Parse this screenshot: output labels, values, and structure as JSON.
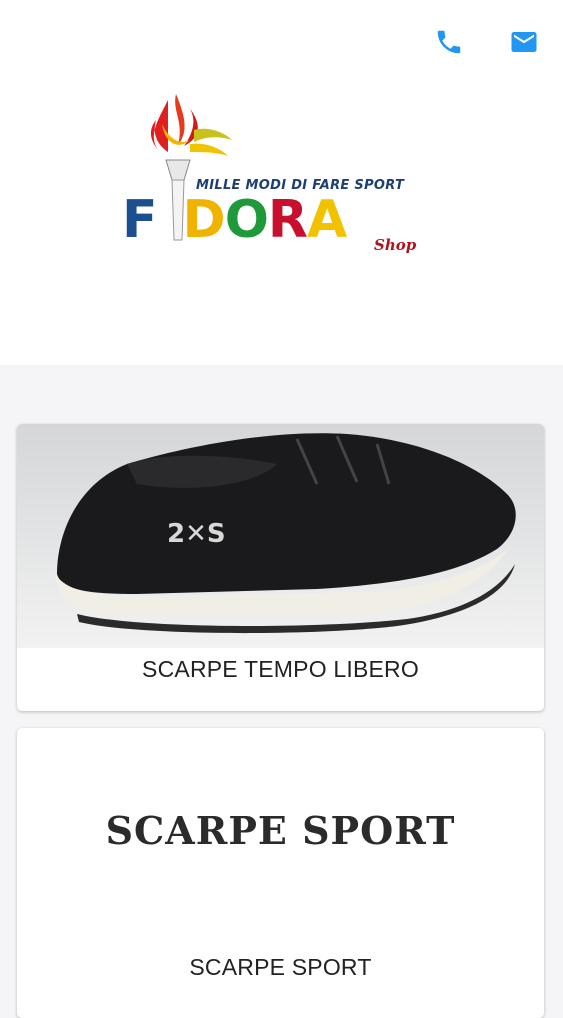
{
  "header": {
    "phone_icon": "phone-icon",
    "mail_icon": "mail-icon",
    "accent_color": "#2196f3",
    "logo": {
      "tagline": "MILLE MODI DI FARE SPORT",
      "brand_letters": [
        "F",
        "I",
        "D",
        "O",
        "R",
        "A"
      ],
      "brand_colors": [
        "#1c4f8f",
        "#cfa300",
        "#f0b400",
        "#1f9a3b",
        "#c8102e",
        "#f2c200"
      ],
      "shop": "Shop"
    }
  },
  "categories": [
    {
      "label": "SCARPE TEMPO LIBERO",
      "image": "black-sneaker-photo"
    },
    {
      "label": "SCARPE SPORT",
      "image_text": "SCARPE SPORT"
    }
  ]
}
